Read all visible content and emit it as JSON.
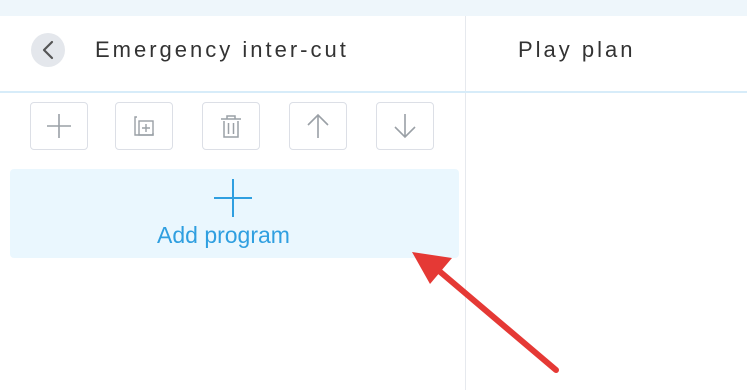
{
  "header": {
    "left_title": "Emergency inter-cut",
    "right_title": "Play plan",
    "back_icon": "chevron-left-icon"
  },
  "toolbar": {
    "buttons": [
      {
        "name": "add",
        "icon": "plus-icon"
      },
      {
        "name": "copy",
        "icon": "copy-icon"
      },
      {
        "name": "delete",
        "icon": "trash-icon"
      },
      {
        "name": "move-up",
        "icon": "arrow-up-icon"
      },
      {
        "name": "move-down",
        "icon": "arrow-down-icon"
      }
    ]
  },
  "add_card": {
    "label": "Add program",
    "icon": "plus-icon"
  },
  "colors": {
    "accent": "#2f9fe0",
    "card_bg": "#eaf7fe",
    "annotation_arrow": "#e53935"
  }
}
